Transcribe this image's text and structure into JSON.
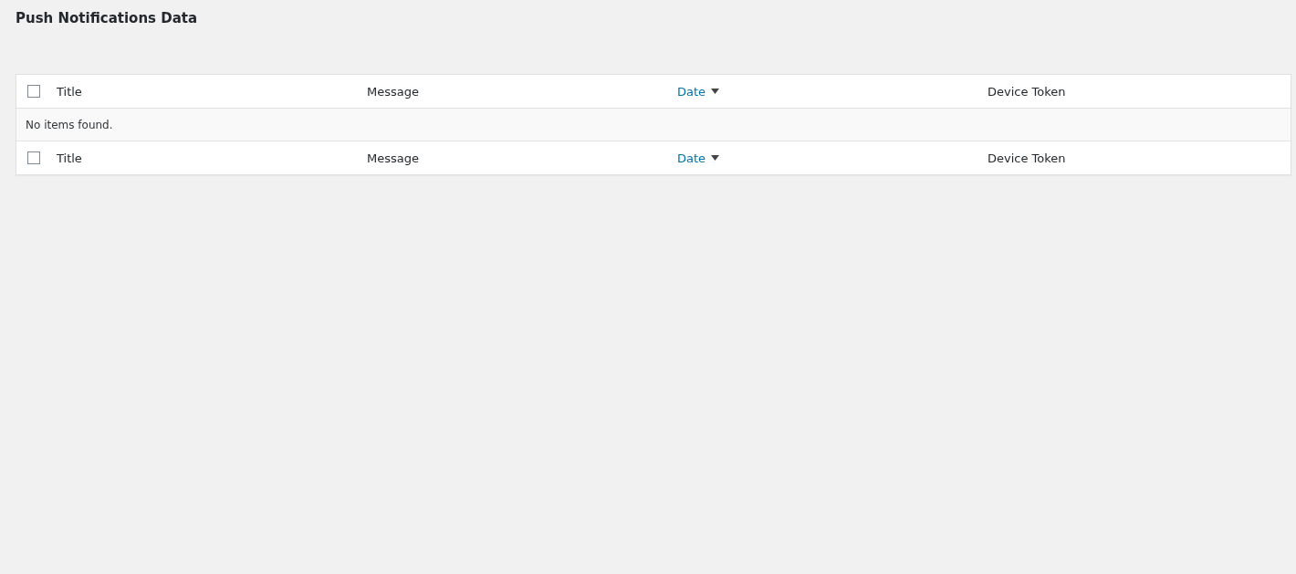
{
  "page_title": "Push Notifications Data",
  "table": {
    "select_all_checked": false,
    "columns": [
      {
        "label": "Title",
        "kind": "plain"
      },
      {
        "label": "Message",
        "kind": "plain"
      },
      {
        "label": "Date",
        "kind": "sortable"
      },
      {
        "label": "Device Token",
        "kind": "plain"
      }
    ],
    "empty_message": "No items found.",
    "footer_select_all_checked": false,
    "footer_columns": [
      {
        "label": "Title",
        "kind": "plain"
      },
      {
        "label": "Message",
        "kind": "plain"
      },
      {
        "label": "Date",
        "kind": "sortable"
      },
      {
        "label": "Device Token",
        "kind": "plain"
      }
    ]
  }
}
